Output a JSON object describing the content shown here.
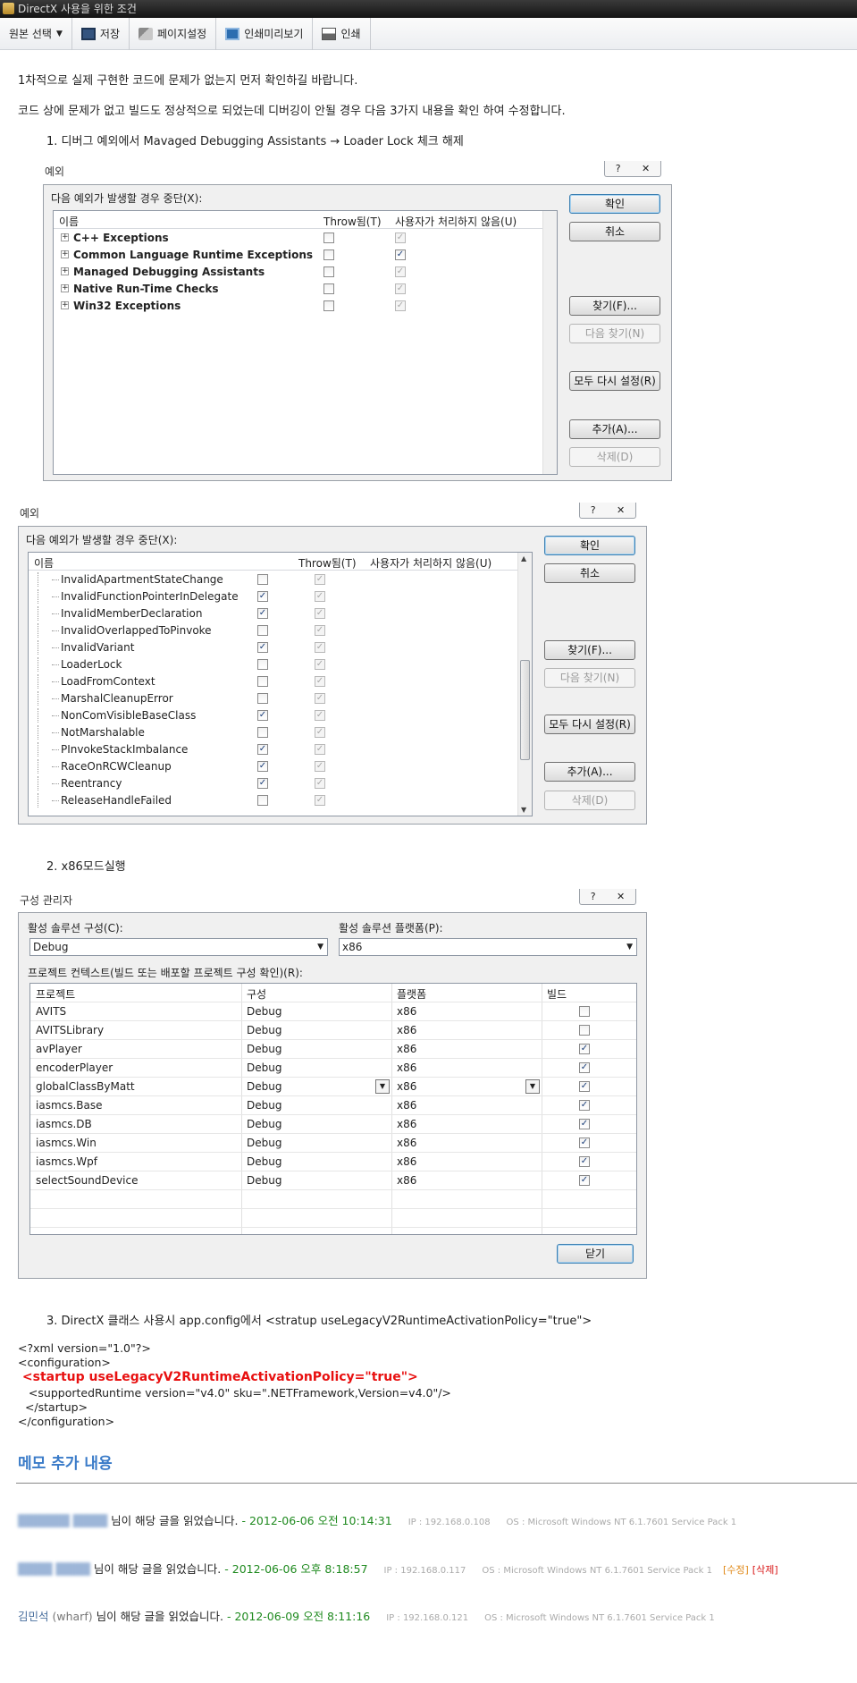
{
  "window": {
    "title": "DirectX 사용을 위한 조건"
  },
  "toolbar": {
    "items": [
      {
        "label": "원본 선택",
        "icon": "dropdown"
      },
      {
        "label": "저장",
        "icon": "save-icon"
      },
      {
        "label": "페이지설정",
        "icon": "page-setup-icon"
      },
      {
        "label": "인쇄미리보기",
        "icon": "print-preview-icon"
      },
      {
        "label": "인쇄",
        "icon": "printer-icon"
      }
    ]
  },
  "content": {
    "intro1": "1차적으로 실제 구현한 코드에 문제가 없는지 먼저 확인하길 바랍니다.",
    "intro2": "코드 상에 문제가 없고 빌드도 정상적으로 되었는데 디버깅이 안될 경우 다음 3가지 내용을 확인 하여 수정합니다.",
    "step1": "1. 디버그 예외에서 Mavaged Debugging Assistants → Loader Lock 체크 해제",
    "step2": "2. x86모드실행",
    "step3": "3. DirectX 클래스 사용시 app.config에서 <stratup useLegacyV2RuntimeActivationPolicy=\"true\">"
  },
  "dialog1": {
    "title": "예외",
    "group_label": "다음 예외가 발생할 경우 중단(X):",
    "columns": [
      "이름",
      "Throw됨(T)",
      "사용자가 처리하지 않음(U)"
    ],
    "rows": [
      {
        "name": "C++ Exceptions",
        "thrown": false,
        "unhandled": true,
        "unhandled_enabled": false
      },
      {
        "name": "Common Language Runtime Exceptions",
        "thrown": false,
        "unhandled": true,
        "unhandled_enabled": true
      },
      {
        "name": "Managed Debugging Assistants",
        "thrown": false,
        "unhandled": true,
        "unhandled_enabled": false
      },
      {
        "name": "Native Run-Time Checks",
        "thrown": false,
        "unhandled": true,
        "unhandled_enabled": false
      },
      {
        "name": "Win32 Exceptions",
        "thrown": false,
        "unhandled": true,
        "unhandled_enabled": false
      }
    ],
    "buttons": {
      "ok": "확인",
      "cancel": "취소",
      "find": "찾기(F)...",
      "find_next": "다음 찾기(N)",
      "reset_all": "모두 다시 설정(R)",
      "add": "추가(A)...",
      "delete": "삭제(D)"
    }
  },
  "dialog2": {
    "title": "예외",
    "group_label": "다음 예외가 발생할 경우 중단(X):",
    "columns": [
      "이름",
      "Throw됨(T)",
      "사용자가 처리하지 않음(U)"
    ],
    "rows": [
      {
        "name": "InvalidApartmentStateChange",
        "thrown": false
      },
      {
        "name": "InvalidFunctionPointerInDelegate",
        "thrown": true
      },
      {
        "name": "InvalidMemberDeclaration",
        "thrown": true
      },
      {
        "name": "InvalidOverlappedToPinvoke",
        "thrown": false
      },
      {
        "name": "InvalidVariant",
        "thrown": true
      },
      {
        "name": "LoaderLock",
        "thrown": false
      },
      {
        "name": "LoadFromContext",
        "thrown": false
      },
      {
        "name": "MarshalCleanupError",
        "thrown": false
      },
      {
        "name": "NonComVisibleBaseClass",
        "thrown": true
      },
      {
        "name": "NotMarshalable",
        "thrown": false
      },
      {
        "name": "PInvokeStackImbalance",
        "thrown": true
      },
      {
        "name": "RaceOnRCWCleanup",
        "thrown": true
      },
      {
        "name": "Reentrancy",
        "thrown": true
      },
      {
        "name": "ReleaseHandleFailed",
        "thrown": false
      }
    ],
    "buttons": {
      "ok": "확인",
      "cancel": "취소",
      "find": "찾기(F)...",
      "find_next": "다음 찾기(N)",
      "reset_all": "모두 다시 설정(R)",
      "add": "추가(A)...",
      "delete": "삭제(D)"
    }
  },
  "dialog3": {
    "title": "구성 관리자",
    "config_label": "활성 솔루션 구성(C):",
    "config_value": "Debug",
    "platform_label": "활성 솔루션 플랫폼(P):",
    "platform_value": "x86",
    "contexts_label": "프로젝트 컨텍스트(빌드 또는 배포할 프로젝트 구성 확인)(R):",
    "columns": [
      "프로젝트",
      "구성",
      "플랫폼",
      "빌드"
    ],
    "rows": [
      {
        "project": "AVITS",
        "config": "Debug",
        "platform": "x86",
        "build": false
      },
      {
        "project": "AVITSLibrary",
        "config": "Debug",
        "platform": "x86",
        "build": false
      },
      {
        "project": "avPlayer",
        "config": "Debug",
        "platform": "x86",
        "build": true
      },
      {
        "project": "encoderPlayer",
        "config": "Debug",
        "platform": "x86",
        "build": true
      },
      {
        "project": "globalClassByMatt",
        "config": "Debug",
        "platform": "x86",
        "build": true
      },
      {
        "project": "iasmcs.Base",
        "config": "Debug",
        "platform": "x86",
        "build": true
      },
      {
        "project": "iasmcs.DB",
        "config": "Debug",
        "platform": "x86",
        "build": true
      },
      {
        "project": "iasmcs.Win",
        "config": "Debug",
        "platform": "x86",
        "build": true
      },
      {
        "project": "iasmcs.Wpf",
        "config": "Debug",
        "platform": "x86",
        "build": true
      },
      {
        "project": "selectSoundDevice",
        "config": "Debug",
        "platform": "x86",
        "build": true
      }
    ],
    "close_button": "닫기"
  },
  "xml": {
    "line1": "<?xml version=\"1.0\"?>",
    "line2": "<configuration>",
    "line3": " <startup useLegacyV2RuntimeActivationPolicy=\"true\">",
    "line4": "   <supportedRuntime version=\"v4.0\" sku=\".NETFramework,Version=v4.0\"/>",
    "line5": "  </startup>",
    "line6": "</configuration>",
    "highlight_color": "#e81010"
  },
  "memo": {
    "section_title": "메모 추가 내용",
    "entries": [
      {
        "name": "",
        "id": "",
        "text": "님이 해당 글을 읽었습니다.",
        "date": "- 2012-06-06 오전 10:14:31",
        "ip": "IP : 192.168.0.108",
        "os": "OS : Microsoft Windows NT 6.1.7601 Service Pack 1",
        "edit": "",
        "delete": ""
      },
      {
        "name": "",
        "id": "",
        "text": "님이 해당 글을 읽었습니다.",
        "date": "- 2012-06-06 오후 8:18:57",
        "ip": "IP : 192.168.0.117",
        "os": "OS : Microsoft Windows NT 6.1.7601 Service Pack 1",
        "edit": "[수정]",
        "delete": "[삭제]"
      },
      {
        "name": "김민석",
        "id": "(wharf)",
        "text": "님이 해당 글을 읽었습니다.",
        "date": "- 2012-06-09 오전 8:11:16",
        "ip": "IP : 192.168.0.121",
        "os": "OS : Microsoft Windows NT 6.1.7601 Service Pack 1",
        "edit": "",
        "delete": ""
      }
    ]
  }
}
